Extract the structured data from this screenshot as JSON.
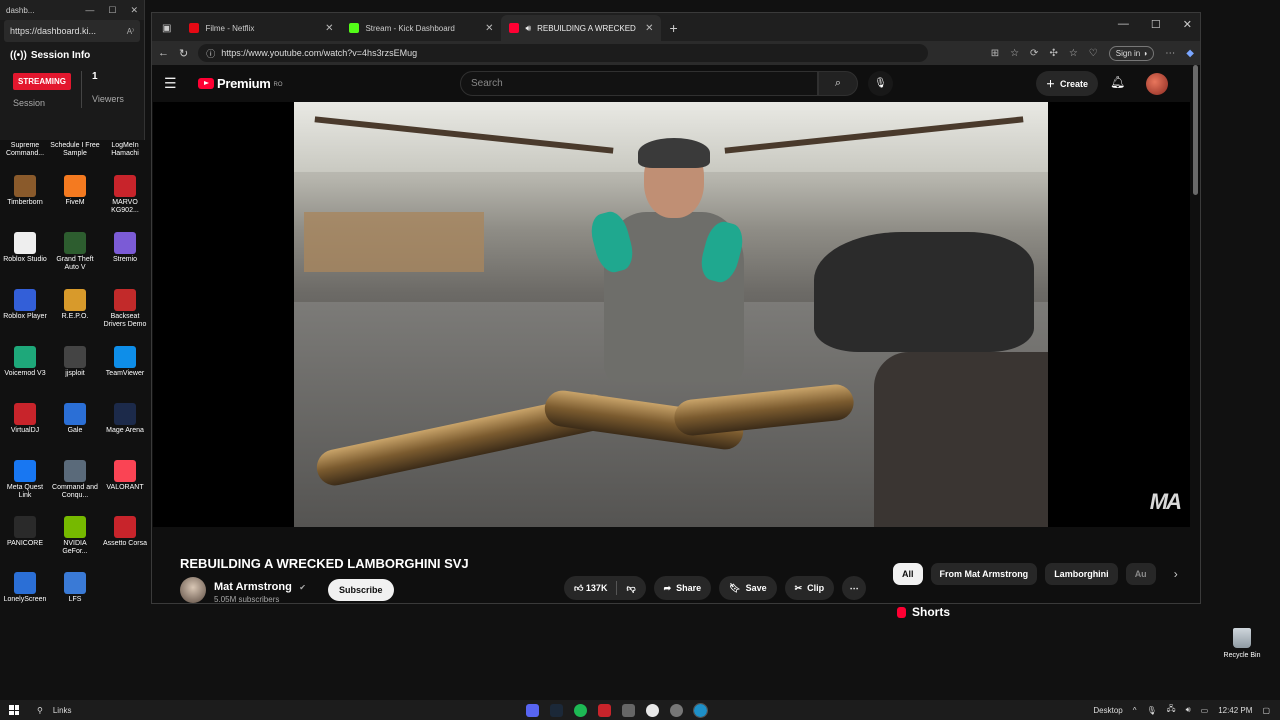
{
  "kick_window": {
    "title": "dashb...",
    "url": "https://dashboard.ki...",
    "session_title": "Session Info",
    "streaming_badge": "STREAMING",
    "session_label": "Session",
    "viewer_count": "1",
    "viewer_label": "Viewers"
  },
  "desktop_icons": [
    {
      "label": "Supreme Command...",
      "icon": "supreme-commander-icon",
      "color": "#3b4a6b"
    },
    {
      "label": "Schedule I Free Sample",
      "icon": "schedule-i-icon",
      "color": "#4c7a3a"
    },
    {
      "label": "LogMeIn Hamachi",
      "icon": "hamachi-icon",
      "color": "#e8a33b"
    },
    {
      "label": "Timberborn",
      "icon": "timberborn-icon",
      "color": "#8a5a2b"
    },
    {
      "label": "FiveM",
      "icon": "fivem-icon",
      "color": "#f47a20"
    },
    {
      "label": "MARVO KG902...",
      "icon": "marvo-icon",
      "color": "#c8242b"
    },
    {
      "label": "Roblox Studio",
      "icon": "roblox-studio-icon",
      "color": "#eeeeee"
    },
    {
      "label": "Grand Theft Auto V",
      "icon": "gta-v-icon",
      "color": "#2d5d2f"
    },
    {
      "label": "Stremio",
      "icon": "stremio-icon",
      "color": "#7b5bd6"
    },
    {
      "label": "Roblox Player",
      "icon": "roblox-player-icon",
      "color": "#335fd8"
    },
    {
      "label": "R.E.P.O.",
      "icon": "repo-icon",
      "color": "#d89a2b"
    },
    {
      "label": "Backseat Drivers Demo",
      "icon": "backseat-drivers-icon",
      "color": "#c22a2a"
    },
    {
      "label": "Voicemod V3",
      "icon": "voicemod-icon",
      "color": "#1ea87a"
    },
    {
      "label": "jjsploit",
      "icon": "jjsploit-icon",
      "color": "#444444"
    },
    {
      "label": "TeamViewer",
      "icon": "teamviewer-icon",
      "color": "#0e8ee9"
    },
    {
      "label": "VirtualDJ",
      "icon": "virtualdj-icon",
      "color": "#c8242b"
    },
    {
      "label": "Gale",
      "icon": "gale-icon",
      "color": "#2b6fd6"
    },
    {
      "label": "Mage Arena",
      "icon": "mage-arena-icon",
      "color": "#1c2a4a"
    },
    {
      "label": "Meta Quest Link",
      "icon": "meta-quest-icon",
      "color": "#1877f2"
    },
    {
      "label": "Command and Conqu...",
      "icon": "command-conquer-icon",
      "color": "#5a6a7a"
    },
    {
      "label": "VALORANT",
      "icon": "valorant-icon",
      "color": "#fa4454"
    },
    {
      "label": "PANICORE",
      "icon": "panicore-icon",
      "color": "#2a2a2a"
    },
    {
      "label": "NVIDIA GeFor...",
      "icon": "nvidia-icon",
      "color": "#76b900"
    },
    {
      "label": "Assetto Corsa",
      "icon": "assetto-corsa-icon",
      "color": "#c8242b"
    },
    {
      "label": "LonelyScreen",
      "icon": "lonelyscreen-icon",
      "color": "#2b6fd6"
    },
    {
      "label": "LFS",
      "icon": "lfs-icon",
      "color": "#3a7ad6"
    }
  ],
  "recycle_bin_label": "Recycle Bin",
  "browser": {
    "tabs": [
      {
        "title": "Filme - Netflix",
        "icon": "netflix-icon",
        "color": "#e50914"
      },
      {
        "title": "Stream - Kick Dashboard",
        "icon": "kick-icon",
        "color": "#53fc18"
      },
      {
        "title": "REBUILDING A WRECKED LA",
        "icon": "youtube-icon",
        "color": "#ff0033"
      }
    ],
    "url": "https://www.youtube.com/watch?v=4hs3rzsEMug",
    "signin_label": "Sign in"
  },
  "youtube": {
    "logo_text": "Premium",
    "country": "RO",
    "search_placeholder": "Search",
    "create_label": "Create",
    "watermark": "MA",
    "video_title": "REBUILDING A WRECKED LAMBORGHINI SVJ",
    "channel_name": "Mat Armstrong",
    "subscribers": "5.05M subscribers",
    "subscribe_label": "Subscribe",
    "likes": "137K",
    "share_label": "Share",
    "save_label": "Save",
    "clip_label": "Clip",
    "chips": [
      "All",
      "From Mat Armstrong",
      "Lamborghini",
      "Au"
    ],
    "shorts_label": "Shorts"
  },
  "taskbar": {
    "search_label": "Links",
    "desktop_label": "Desktop",
    "time": "12:42 PM"
  }
}
